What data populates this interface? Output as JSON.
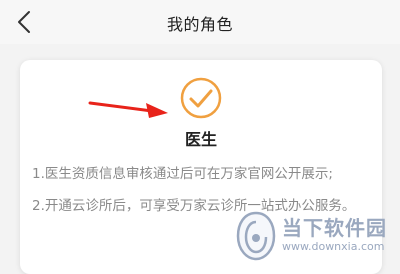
{
  "header": {
    "title": "我的角色",
    "back_icon": "chevron-left-icon"
  },
  "card": {
    "role_icon": "check-circle-icon",
    "role_name": "医生",
    "notes": [
      "1.医生资质信息审核通过后可在万家官网公开展示;",
      "2.开通云诊所后，可享受万家云诊所一站式办公服务。"
    ]
  },
  "annotation": {
    "arrow_color": "#e8231a"
  },
  "watermark": {
    "title": "当下软件园",
    "url": "www.downxia.com"
  },
  "colors": {
    "accent": "#f0a040",
    "text_primary": "#222222",
    "text_secondary": "#8a8a8a"
  }
}
